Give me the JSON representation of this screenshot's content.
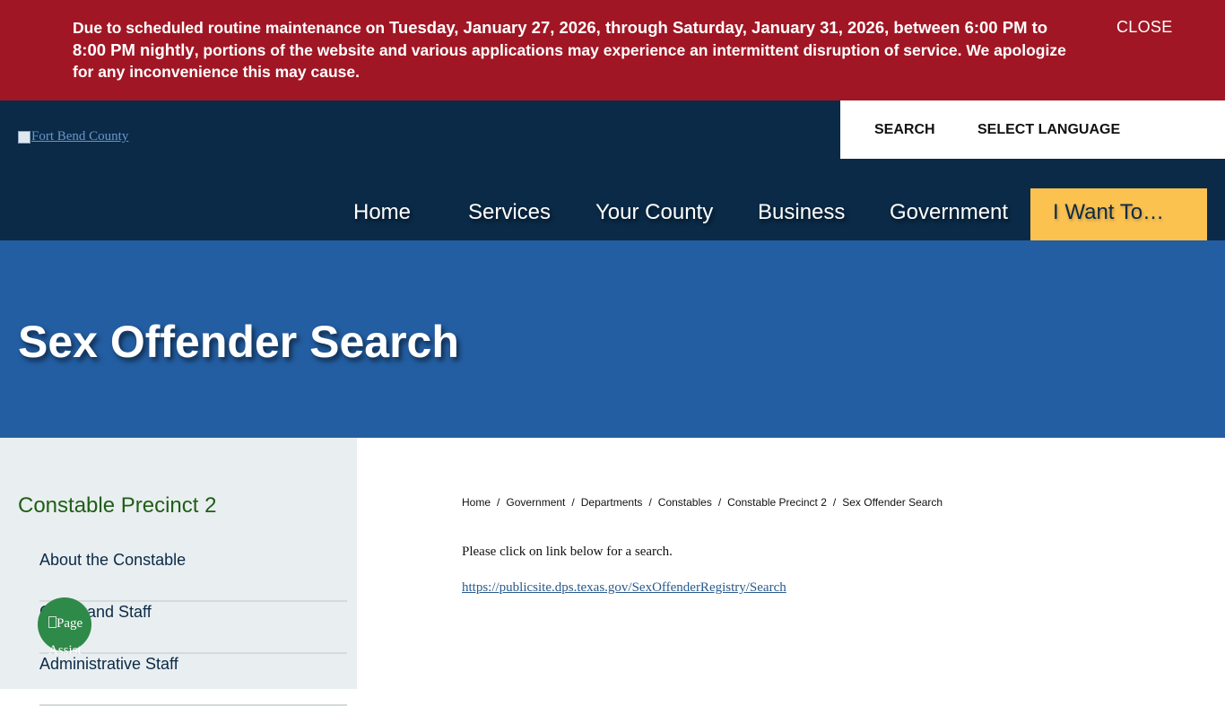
{
  "alert": {
    "text_lead": "Due to scheduled routine maintenance on ",
    "dates": "Tuesday, January 27, 2026, through Saturday, January 31, 2026, between 6:00 PM to 8:00 PM nightly",
    "text_tail": ", portions of the website and various applications may experience an intermittent disruption of service. We apologize for any inconvenience this may cause.",
    "close_label": "CLOSE"
  },
  "header": {
    "logo_alt": "Fort Bend County",
    "search_label": "SEARCH",
    "language_label": "SELECT LANGUAGE"
  },
  "nav": {
    "items": [
      "Home",
      "Services",
      "Your County",
      "Business",
      "Government"
    ],
    "cta": "I Want To…"
  },
  "banner": {
    "title": "Sex Offender Search"
  },
  "sidebar": {
    "title": "Constable Precinct 2",
    "items": [
      "About the Constable",
      "Command Staff",
      "Administrative Staff"
    ]
  },
  "fab": {
    "alt": "PageAssist"
  },
  "breadcrumb": [
    "Home",
    "Government",
    "Departments",
    "Constables",
    "Constable Precinct 2",
    "Sex Offender Search"
  ],
  "content": {
    "intro": "Please click on link below for a search.",
    "link": "https://publicsite.dps.texas.gov/SexOffenderRegistry/Search"
  },
  "colors": {
    "alert_bg": "#a11624",
    "header_bg": "#0a2a47",
    "cta_bg": "#fcc250",
    "banner_bg": "#235ea2",
    "sidebar_bg": "#e9eef0",
    "sidebar_title": "#1f5e16",
    "fab_bg": "#2e8a48"
  }
}
